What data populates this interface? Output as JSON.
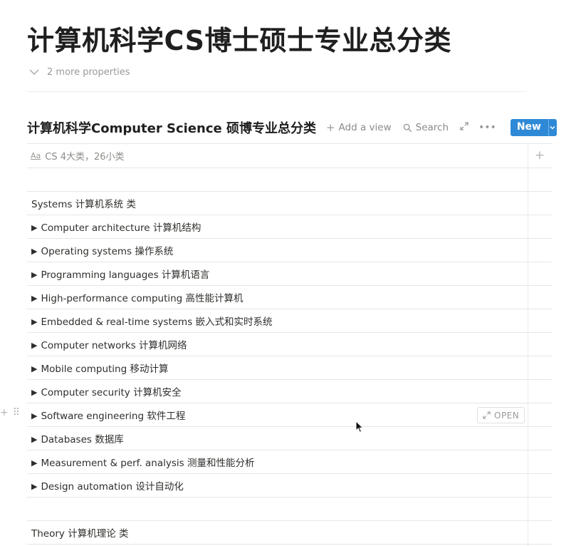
{
  "page": {
    "title": "计算机科学CS博士硕士专业总分类",
    "more_properties": "2 more properties"
  },
  "database": {
    "title": "计算机科学Computer Science 硕博专业总分类",
    "add_view": "Add a view",
    "search": "Search",
    "new_label": "New",
    "column_header": "CS 4大类，26小类",
    "open_label": "OPEN"
  },
  "rows": [
    {
      "label": "Systems 计算机系统 类"
    },
    {
      "label": "Computer architecture 计算机结构"
    },
    {
      "label": "Operating systems 操作系统"
    },
    {
      "label": "Programming languages 计算机语言"
    },
    {
      "label": "High-performance computing 高性能计算机"
    },
    {
      "label": "Embedded & real-time systems 嵌入式和实时系统"
    },
    {
      "label": "Computer networks 计算机网络"
    },
    {
      "label": "Mobile computing 移动计算"
    },
    {
      "label": "Computer security 计算机安全"
    },
    {
      "label": "Software engineering 软件工程"
    },
    {
      "label": "Databases 数据库"
    },
    {
      "label": "Measurement & perf. analysis 测量和性能分析"
    },
    {
      "label": "Design automation 设计自动化"
    },
    {
      "label": "Theory 计算机理论 类"
    }
  ],
  "icons": {
    "chevron": "chevron-down-icon",
    "plus": "plus-icon",
    "search": "search-icon",
    "expand": "expand-icon",
    "more": "more-icon",
    "toggle": "toggle-triangle-icon"
  },
  "colors": {
    "accent": "#2e8ad6"
  }
}
